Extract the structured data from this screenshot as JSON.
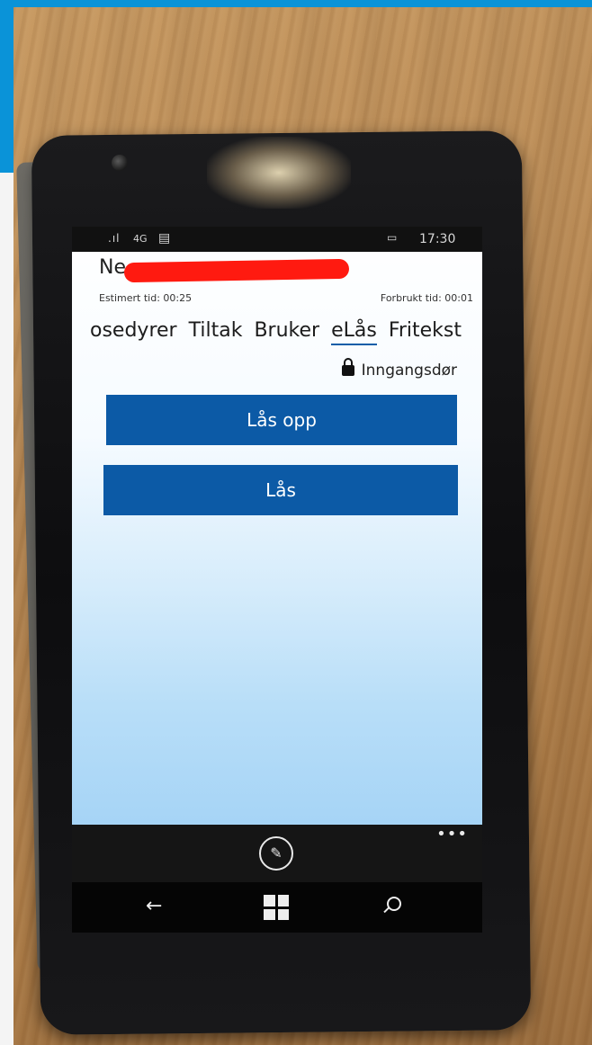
{
  "status_bar": {
    "signal": ".ıl",
    "network": "4G",
    "message_icon": "message-icon",
    "battery_icon": "battery-icon",
    "time": "17:30"
  },
  "header": {
    "name_prefix": "Ne",
    "estimated_time": "Estimert tid: 00:25",
    "used_time": "Forbrukt tid: 00:01"
  },
  "tabs": [
    {
      "label": "osedyrer",
      "active": false
    },
    {
      "label": "Tiltak",
      "active": false
    },
    {
      "label": "Bruker",
      "active": false
    },
    {
      "label": "eLås",
      "active": true
    },
    {
      "label": "Fritekst",
      "active": false
    }
  ],
  "lock": {
    "icon": "lock-icon",
    "door_label": "Inngangsdør",
    "unlock_button": "Lås opp",
    "lock_button": "Lås"
  },
  "app_bar": {
    "edit_icon": "edit-icon",
    "more": "•••"
  },
  "nav_bar": {
    "back": "←",
    "home_icon": "windows-icon",
    "search_icon": "search-icon"
  },
  "colors": {
    "accent": "#0c5aa6",
    "frame": "#0a93d8",
    "redaction": "#ff1a10"
  }
}
